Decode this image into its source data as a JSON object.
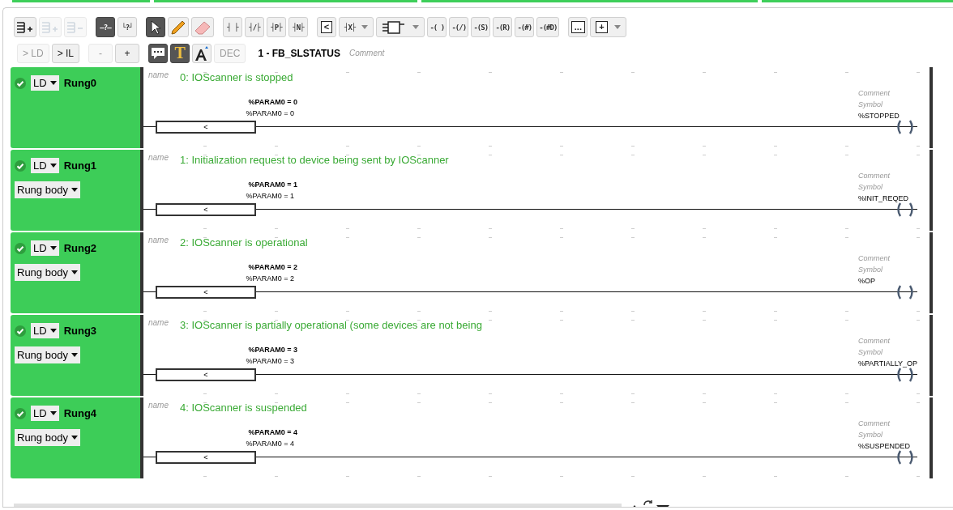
{
  "toolbar": {
    "row1": [
      [
        {
          "kind": "icon",
          "disabled": false,
          "pressed": false,
          "dropdown": false
        },
        {
          "kind": "icon",
          "disabled": true,
          "pressed": false,
          "dropdown": false
        },
        {
          "kind": "icon",
          "disabled": true,
          "pressed": false,
          "dropdown": false
        }
      ],
      [
        {
          "kind": "glyph",
          "glyph": "–?–",
          "disabled": false,
          "pressed": true,
          "dropdown": false
        },
        {
          "kind": "glyph",
          "glyph": "└?┘",
          "disabled": false,
          "pressed": false,
          "dropdown": false
        }
      ],
      [
        {
          "kind": "icon",
          "disabled": false,
          "pressed": true,
          "dropdown": false
        },
        {
          "kind": "icon",
          "disabled": false,
          "pressed": false,
          "dropdown": false
        },
        {
          "kind": "icon",
          "disabled": false,
          "pressed": false,
          "dropdown": false
        }
      ],
      [
        {
          "kind": "glyph",
          "glyph": "┤ ├",
          "disabled": false,
          "pressed": false,
          "dropdown": false
        },
        {
          "kind": "glyph",
          "glyph": "┤/├",
          "disabled": false,
          "pressed": false,
          "dropdown": false
        },
        {
          "kind": "glyph",
          "glyph": "┤P├",
          "disabled": false,
          "pressed": false,
          "dropdown": false
        },
        {
          "kind": "glyph",
          "glyph": "┤N├",
          "disabled": false,
          "pressed": false,
          "dropdown": false
        }
      ],
      [
        {
          "kind": "boxed",
          "glyph": "<",
          "disabled": false,
          "pressed": false,
          "dropdown": false
        },
        {
          "kind": "glyph",
          "glyph": "┤X├",
          "disabled": false,
          "pressed": false,
          "dropdown": true
        },
        {
          "kind": "icon",
          "disabled": false,
          "pressed": false,
          "dropdown": true
        },
        {
          "kind": "glyph",
          "glyph": "-( )",
          "disabled": false,
          "pressed": false,
          "dropdown": false
        },
        {
          "kind": "glyph",
          "glyph": "-(/)",
          "disabled": false,
          "pressed": false,
          "dropdown": false
        },
        {
          "kind": "glyph",
          "glyph": "-(S)",
          "disabled": false,
          "pressed": false,
          "dropdown": false
        },
        {
          "kind": "glyph",
          "glyph": "-(R)",
          "disabled": false,
          "pressed": false,
          "dropdown": false
        },
        {
          "kind": "glyph",
          "glyph": "-(#)",
          "disabled": false,
          "pressed": false,
          "dropdown": false
        },
        {
          "kind": "glyph",
          "glyph": "-(#D)",
          "disabled": false,
          "pressed": false,
          "dropdown": false
        }
      ],
      [
        {
          "kind": "boxed",
          "glyph": "...",
          "disabled": false,
          "pressed": false,
          "dropdown": false
        },
        {
          "kind": "boxed",
          "glyph": "+",
          "disabled": false,
          "pressed": false,
          "dropdown": true
        }
      ]
    ],
    "row2": [
      [
        {
          "kind": "text",
          "label": "> LD",
          "disabled": true,
          "pressed": false
        },
        {
          "kind": "text",
          "label": "> IL",
          "disabled": false,
          "pressed": false
        }
      ],
      [
        {
          "kind": "text",
          "label": "-",
          "disabled": true,
          "pressed": false
        },
        {
          "kind": "text",
          "label": "+",
          "disabled": false,
          "pressed": false
        }
      ],
      [
        {
          "kind": "icon",
          "disabled": false,
          "pressed": true
        },
        {
          "kind": "glyph",
          "glyph": "T",
          "disabled": false,
          "pressed": true
        },
        {
          "kind": "icon",
          "disabled": false,
          "pressed": false
        },
        {
          "kind": "text",
          "label": "DEC",
          "disabled": true,
          "pressed": false
        }
      ]
    ],
    "title": "1 - FB_SLSTATUS",
    "title_comment": "Comment"
  },
  "rungs": [
    {
      "name": "Rung0",
      "checked": true,
      "language": "LD",
      "name_label": "name",
      "comment": "0: IOScanner is stopped",
      "compare": {
        "title": "%PARAM0 = 0",
        "expression": "%PARAM0 = 0",
        "operator": "<"
      },
      "coil": {
        "comment": "Comment",
        "symbol": "Symbol",
        "address": "%STOPPED"
      }
    },
    {
      "name": "Rung1",
      "checked": true,
      "language": "LD",
      "section": "Rung body",
      "name_label": "name",
      "comment": "1: Initialization request to device being sent by IOScanner",
      "compare": {
        "title": "%PARAM0 = 1",
        "expression": "%PARAM0 = 1",
        "operator": "<"
      },
      "coil": {
        "comment": "Comment",
        "symbol": "Symbol",
        "address": "%INIT_REQED"
      }
    },
    {
      "name": "Rung2",
      "checked": true,
      "language": "LD",
      "section": "Rung body",
      "name_label": "name",
      "comment": "2: IOScanner is operational",
      "compare": {
        "title": "%PARAM0 = 2",
        "expression": "%PARAM0 = 2",
        "operator": "<"
      },
      "coil": {
        "comment": "Comment",
        "symbol": "Symbol",
        "address": "%OP"
      }
    },
    {
      "name": "Rung3",
      "checked": true,
      "language": "LD",
      "section": "Rung body",
      "name_label": "name",
      "comment": "3: IOScanner is partially operational (some devices are not being",
      "compare": {
        "title": "%PARAM0 = 3",
        "expression": "%PARAM0 = 3",
        "operator": "<"
      },
      "coil": {
        "comment": "Comment",
        "symbol": "Symbol",
        "address": "%PARTIALLY_OP"
      }
    },
    {
      "name": "Rung4",
      "checked": true,
      "language": "LD",
      "section": "Rung body",
      "name_label": "name",
      "comment": "4: IOScanner is suspended",
      "compare": {
        "title": "%PARAM0 = 4",
        "expression": "%PARAM0 = 4",
        "operator": "<"
      },
      "coil": {
        "comment": "Comment",
        "symbol": "Symbol",
        "address": "%SUSPENDED"
      }
    }
  ]
}
